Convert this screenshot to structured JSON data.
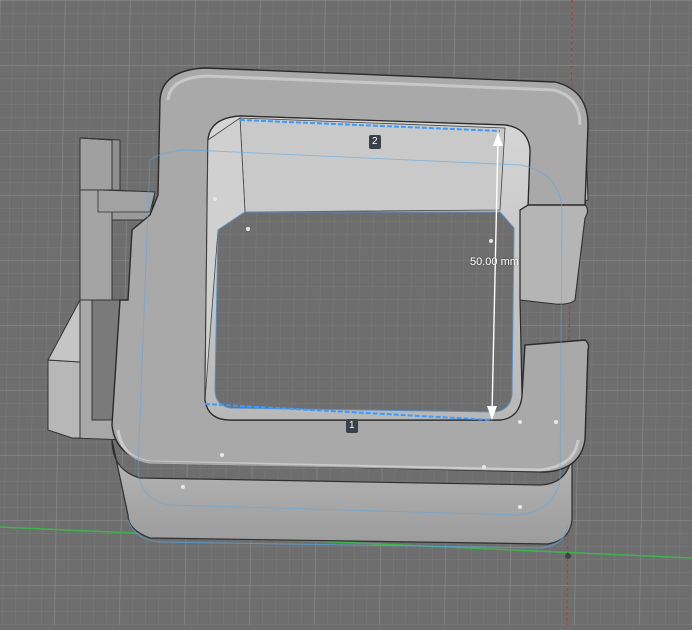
{
  "viewport": {
    "dimension_label": "50.00 mm",
    "edge_labels": [
      "2",
      "1"
    ]
  },
  "colors": {
    "background": "#6e6e6e",
    "grid_minor": "#7a7a7a",
    "grid_major": "#8a8a8a",
    "axis_x": "#3fb34f",
    "axis_y": "#c0392b",
    "model_top": "#a8a8a8",
    "model_side": "#c4c4c4",
    "selection": "#3b9bff"
  },
  "icons": {
    "selected_edge": "selected-edge-icon",
    "dimension_arrow": "dimension-arrow-icon"
  }
}
